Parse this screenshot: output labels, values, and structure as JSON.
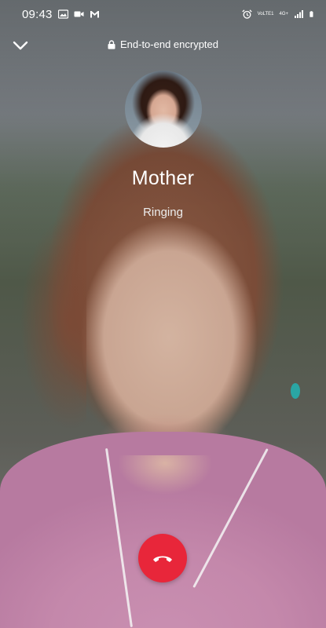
{
  "status_bar": {
    "time": "09:43",
    "notification_icons": [
      "gallery-icon",
      "video-call-icon",
      "gmail-icon"
    ],
    "system_icons": [
      "alarm-icon",
      "volte-icon",
      "network-type-icon",
      "signal-icon",
      "battery-icon"
    ],
    "volte_label": "VoLTE1",
    "network_label": "4G+"
  },
  "top_bar": {
    "collapse_icon": "chevron-down-icon",
    "encryption_text": "End-to-end encrypted",
    "lock_icon": "lock-icon"
  },
  "call": {
    "caller_name": "Mother",
    "status": "Ringing"
  },
  "controls": {
    "end_call_icon": "hang-up-icon",
    "end_call_color": "#e8263a"
  }
}
